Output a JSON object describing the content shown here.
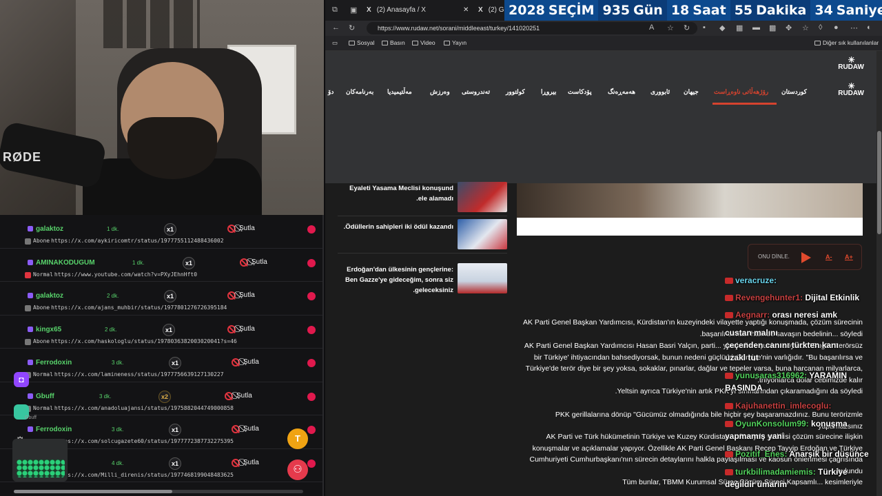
{
  "countdown": {
    "year": "2028",
    "label": "SEÇİM",
    "days": "935",
    "days_label": "Gün",
    "hours": "18",
    "hours_label": "Saat",
    "minutes": "55",
    "minutes_label": "Dakika",
    "seconds": "34",
    "seconds_label": "Saniye"
  },
  "webcam": {
    "mic_label": "RØDE"
  },
  "chat": {
    "items": [
      {
        "user": "galaktoz",
        "time": "1 dk.",
        "count": "x1",
        "skip": "Şutla",
        "type": "Abone",
        "url": "https://x.com/aykiricomtr/status/1977755112488436002"
      },
      {
        "user": "AMINAKODUGUM",
        "time": "1 dk.",
        "count": "x1",
        "skip": "Şutla",
        "type": "Normal",
        "url": "https://www.youtube.com/watch?v=PXyJEhnHft0"
      },
      {
        "user": "galaktoz",
        "time": "2 dk.",
        "count": "x1",
        "skip": "Şutla",
        "type": "Abone",
        "url": "https://x.com/ajans_muhbir/status/1977801276726395184"
      },
      {
        "user": "kingx65",
        "time": "2 dk.",
        "count": "x1",
        "skip": "Şutla",
        "type": "Abone",
        "url": "https://x.com/haskologlu/status/1978036382003020041?s=46"
      },
      {
        "user": "Ferrodoxin",
        "time": "3 dk.",
        "count": "x1",
        "skip": "Şutla",
        "type": "Normal",
        "url": "https://x.com/lamineness/status/1977756639127130227"
      },
      {
        "user": "Gbuff",
        "time": "3 dk.",
        "count": "x2",
        "skip": "Şutla",
        "type": "Normal",
        "url": "https://x.com/anadoluajansi/status/1975882044749000858"
      },
      {
        "user": "Ferrodoxin",
        "time": "3 dk.",
        "count": "x1",
        "skip": "Şutla",
        "type": "Normal",
        "url": "https://x.com/solcugazete60/status/1977772387732275395"
      },
      {
        "user": "",
        "time": "4 dk.",
        "count": "x1",
        "skip": "Şutla",
        "type": "Normal",
        "url": "https://x.com/Milli_direnis/status/1977468199048483625"
      }
    ],
    "side_sub": "Gbuff",
    "t_button": "T"
  },
  "browser": {
    "tabs": [
      "(2) Anasayfa / X",
      "(2) Gö"
    ],
    "url": "https://www.rudaw.net/sorani/middleeast/turkey/141020251",
    "bookmarks": [
      "Sosyal",
      "Basın",
      "Video",
      "Yayın"
    ],
    "other_bookmarks": "Diğer sık kullanılanlar"
  },
  "site": {
    "logo": "RUDAW",
    "nav": [
      "کوردستان",
      "رۆژهەڵاتی ناوەڕاست",
      "جیهان",
      "ئابووری",
      "هەمەڕەنگ",
      "پۆدکاست",
      "بیروڕا",
      "کولتوور",
      "تەندروستی",
      "وەرزش",
      "مەڵتیمیدیا",
      "بەرنامەکان",
      "دۆ"
    ],
    "side_news": [
      {
        "text": "Eyaleti Yasama Meclisi konuşund ele alamadı."
      },
      {
        "text": "Ödüllerin sahipleri iki ödül kazandı."
      },
      {
        "text": "Erdoğan'dan ülkesinin gençlerine: Ben Gazze'ye gideceğim, sonra siz geleceksiniz."
      }
    ],
    "listen": {
      "label": "ONU DİNLE.",
      "minus": "A-",
      "plus": "A+"
    },
    "paragraphs": [
      "AK Parti Genel Başkan Yardımcısı, Kürdistan'ın kuzeyindeki vilayette yaptığı konuşmada, çözüm sürecinin başarılı olması halinde savaşın bedelinin... söyledi.",
      "AK Parti Genel Başkan Yardımcısı Hasan Basri Yalçın, parti... yineledi ve şunları söyledi: \"Bugün 'terörsüz bir Türkiye' ihtiyacından bahsediyorsak, bunun nedeni güçlü bir Türkiye'nin varlığıdır. \"Bu başarılırsa ve Türkiye'de terör diye bir şey yoksa, sokaklar, pınarlar, dağlar ve tepeler varsa, buna harcanan milyarlarca, trilyonlarca dolar cebimizde kalır.\"",
      "Yeltsin ayrıca Türkiye'nin artık PKK'yı sınırlarından çıkaramadığını da söyledi.",
      "PKK gerillalarına dönüp \"Gücümüz olmadığında bile hiçbir şey başaramazdınız. Bunu terörizmle yapamazsınız",
      "AK Parti ve Türk hükümetinin Türkiye ve Kuzey Kürdistan... düzeyde yetkilisi çözüm sürecine ilişkin konuşmalar ve açıklamalar yapıyor. Özellikle AK Parti Genel Başkanı Recep Tayyip Erdoğan ve Türkiye Cumhuriyeti Cumhurbaşkanı'nın sürecin detaylarını halkla paylaşılması ve kaosun önlenmesi çağrısında bulundu.",
      "Tüm bunlar, TBMM Kurumsal Süreç Çözüm Süreci Kapsamlı... kesimleriyle"
    ]
  },
  "stream_chat": [
    {
      "user": "veracruze:",
      "msg": ""
    },
    {
      "user": "Revengehunter1:",
      "msg": "Dijital Etkinlik"
    },
    {
      "user": "Aegnarr:",
      "msg": "orası neresi amk"
    },
    {
      "user": "",
      "msg": "custan malını"
    },
    {
      "user": "",
      "msg": "çeçenden canını türkten kanı"
    },
    {
      "user": "",
      "msg": "uzakl tut"
    },
    {
      "user": "yunusaras316962:",
      "msg": "YARAMIN"
    },
    {
      "user": "",
      "msg": "BASINDA"
    },
    {
      "user": "Kajuhanettin_imlecoglu:",
      "msg": ""
    },
    {
      "user": "OyunKonsolum99:",
      "msg": "konuşma"
    },
    {
      "user": "",
      "msg": "yapmamış yani"
    },
    {
      "user": "Pozitif_Enes:",
      "msg": "Anarşik bir düşünce"
    },
    {
      "user": "turkbilimadamiemis:",
      "msg": "Türkiye"
    },
    {
      "user": "",
      "msg": "değildir umarım"
    }
  ]
}
